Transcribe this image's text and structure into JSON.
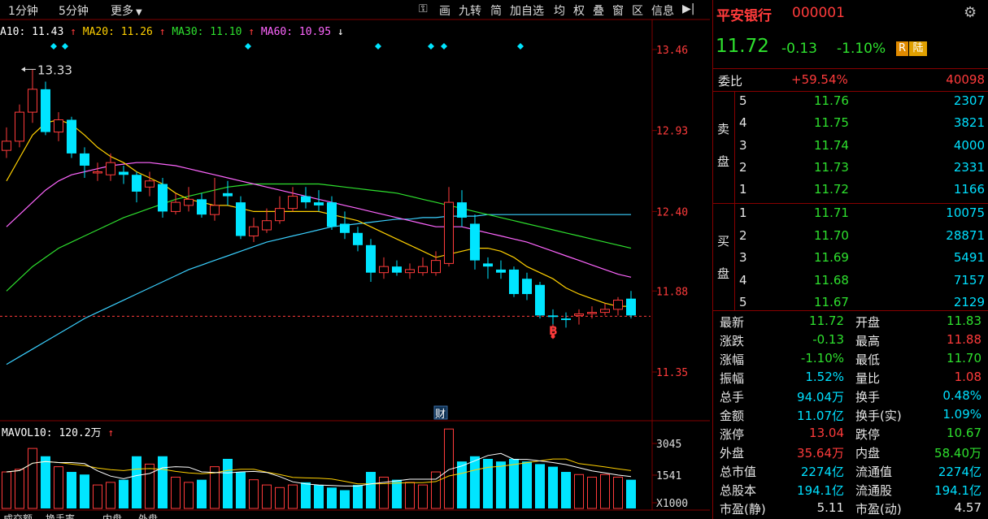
{
  "toolbar": {
    "period_1min": "1分钟",
    "period_5min": "5分钟",
    "more": "更多",
    "tools": [
      "画",
      "九转",
      "简",
      "加自选",
      "均",
      "权",
      "叠",
      "窗",
      "区",
      "信息"
    ]
  },
  "indicators": {
    "ma10": "A10: 11.43",
    "ma20": "MA20: 11.26",
    "ma30": "MA30: 11.10",
    "ma60": "MA60: 10.95",
    "ma10_arrow": "↑",
    "ma20_arrow": "↑",
    "ma30_arrow": "↑",
    "ma60_arrow": "↓"
  },
  "vol_indicator": {
    "label": "MAVOL10: 120.2万",
    "arrow": "↑"
  },
  "chart_data": {
    "type": "candlestick",
    "y_ticks": [
      "13.46",
      "12.93",
      "12.40",
      "11.88",
      "11.35"
    ],
    "vol_ticks": [
      "3045",
      "1541",
      "X1000"
    ],
    "high_label": "13.33",
    "low_marker": "B",
    "finance_marker": "财",
    "candles": [
      {
        "o": 12.8,
        "c": 12.86,
        "h": 12.95,
        "l": 12.75,
        "v": 1400,
        "up": true
      },
      {
        "o": 12.86,
        "c": 13.05,
        "h": 13.1,
        "l": 12.82,
        "v": 1500,
        "up": true
      },
      {
        "o": 13.05,
        "c": 13.2,
        "h": 13.33,
        "l": 12.98,
        "v": 2300,
        "up": true
      },
      {
        "o": 13.2,
        "c": 12.92,
        "h": 13.25,
        "l": 12.9,
        "v": 2000,
        "up": false
      },
      {
        "o": 12.92,
        "c": 13.0,
        "h": 13.05,
        "l": 12.86,
        "v": 1600,
        "up": true
      },
      {
        "o": 13.0,
        "c": 12.78,
        "h": 13.02,
        "l": 12.75,
        "v": 1400,
        "up": false
      },
      {
        "o": 12.78,
        "c": 12.7,
        "h": 12.82,
        "l": 12.62,
        "v": 1300,
        "up": false
      },
      {
        "o": 12.66,
        "c": 12.66,
        "h": 12.72,
        "l": 12.6,
        "v": 900,
        "up": true
      },
      {
        "o": 12.64,
        "c": 12.72,
        "h": 12.78,
        "l": 12.6,
        "v": 1000,
        "up": true
      },
      {
        "o": 12.66,
        "c": 12.64,
        "h": 12.7,
        "l": 12.58,
        "v": 1100,
        "up": false
      },
      {
        "o": 12.64,
        "c": 12.53,
        "h": 12.66,
        "l": 12.46,
        "v": 2000,
        "up": false
      },
      {
        "o": 12.56,
        "c": 12.6,
        "h": 12.66,
        "l": 12.5,
        "v": 1700,
        "up": true
      },
      {
        "o": 12.58,
        "c": 12.4,
        "h": 12.62,
        "l": 12.36,
        "v": 2000,
        "up": false
      },
      {
        "o": 12.4,
        "c": 12.46,
        "h": 12.52,
        "l": 12.38,
        "v": 1200,
        "up": true
      },
      {
        "o": 12.44,
        "c": 12.48,
        "h": 12.56,
        "l": 12.4,
        "v": 1000,
        "up": true
      },
      {
        "o": 12.48,
        "c": 12.38,
        "h": 12.52,
        "l": 12.36,
        "v": 1100,
        "up": false
      },
      {
        "o": 12.38,
        "c": 12.44,
        "h": 12.62,
        "l": 12.34,
        "v": 1600,
        "up": true
      },
      {
        "o": 12.52,
        "c": 12.5,
        "h": 12.6,
        "l": 12.44,
        "v": 1900,
        "up": false
      },
      {
        "o": 12.46,
        "c": 12.24,
        "h": 12.5,
        "l": 12.22,
        "v": 1400,
        "up": false
      },
      {
        "o": 12.24,
        "c": 12.3,
        "h": 12.36,
        "l": 12.2,
        "v": 1100,
        "up": true
      },
      {
        "o": 12.28,
        "c": 12.34,
        "h": 12.42,
        "l": 12.26,
        "v": 900,
        "up": true
      },
      {
        "o": 12.34,
        "c": 12.42,
        "h": 12.5,
        "l": 12.32,
        "v": 800,
        "up": true
      },
      {
        "o": 12.42,
        "c": 12.5,
        "h": 12.56,
        "l": 12.4,
        "v": 900,
        "up": true
      },
      {
        "o": 12.5,
        "c": 12.46,
        "h": 12.56,
        "l": 12.42,
        "v": 1000,
        "up": false
      },
      {
        "o": 12.46,
        "c": 12.44,
        "h": 12.54,
        "l": 12.4,
        "v": 900,
        "up": false
      },
      {
        "o": 12.46,
        "c": 12.3,
        "h": 12.5,
        "l": 12.28,
        "v": 800,
        "up": false
      },
      {
        "o": 12.32,
        "c": 12.26,
        "h": 12.4,
        "l": 12.22,
        "v": 700,
        "up": false
      },
      {
        "o": 12.26,
        "c": 12.18,
        "h": 12.3,
        "l": 12.14,
        "v": 900,
        "up": false
      },
      {
        "o": 12.18,
        "c": 12.0,
        "h": 12.22,
        "l": 11.94,
        "v": 1400,
        "up": false
      },
      {
        "o": 12.0,
        "c": 12.04,
        "h": 12.1,
        "l": 11.96,
        "v": 1200,
        "up": true
      },
      {
        "o": 12.04,
        "c": 12.0,
        "h": 12.08,
        "l": 11.98,
        "v": 1100,
        "up": false
      },
      {
        "o": 12.0,
        "c": 12.02,
        "h": 12.06,
        "l": 11.96,
        "v": 1000,
        "up": true
      },
      {
        "o": 12.0,
        "c": 12.04,
        "h": 12.1,
        "l": 11.98,
        "v": 900,
        "up": true
      },
      {
        "o": 12.0,
        "c": 12.08,
        "h": 12.14,
        "l": 11.98,
        "v": 1400,
        "up": true
      },
      {
        "o": 12.06,
        "c": 12.46,
        "h": 12.56,
        "l": 12.04,
        "v": 3045,
        "up": true
      },
      {
        "o": 12.46,
        "c": 12.36,
        "h": 12.54,
        "l": 12.3,
        "v": 1800,
        "up": false
      },
      {
        "o": 12.32,
        "c": 12.08,
        "h": 12.38,
        "l": 12.02,
        "v": 2000,
        "up": false
      },
      {
        "o": 12.06,
        "c": 12.04,
        "h": 12.1,
        "l": 11.96,
        "v": 1900,
        "up": false
      },
      {
        "o": 12.02,
        "c": 12.0,
        "h": 12.08,
        "l": 11.96,
        "v": 1800,
        "up": false
      },
      {
        "o": 12.02,
        "c": 11.86,
        "h": 12.04,
        "l": 11.84,
        "v": 1900,
        "up": false
      },
      {
        "o": 11.96,
        "c": 11.86,
        "h": 12.0,
        "l": 11.82,
        "v": 1800,
        "up": false
      },
      {
        "o": 11.92,
        "c": 11.72,
        "h": 11.94,
        "l": 11.7,
        "v": 1700,
        "up": false
      },
      {
        "o": 11.72,
        "c": 11.71,
        "h": 11.76,
        "l": 11.62,
        "v": 1600,
        "up": false
      },
      {
        "o": 11.7,
        "c": 11.69,
        "h": 11.74,
        "l": 11.64,
        "v": 1400,
        "up": false
      },
      {
        "o": 11.72,
        "c": 11.73,
        "h": 11.76,
        "l": 11.66,
        "v": 1300,
        "up": true
      },
      {
        "o": 11.74,
        "c": 11.74,
        "h": 11.78,
        "l": 11.7,
        "v": 1200,
        "up": true
      },
      {
        "o": 11.74,
        "c": 11.76,
        "h": 11.8,
        "l": 11.72,
        "v": 1300,
        "up": true
      },
      {
        "o": 11.76,
        "c": 11.82,
        "h": 11.84,
        "l": 11.72,
        "v": 1200,
        "up": true
      },
      {
        "o": 11.83,
        "c": 11.72,
        "h": 11.88,
        "l": 11.7,
        "v": 1100,
        "up": false
      }
    ],
    "ma10": [
      12.6,
      12.75,
      12.9,
      12.98,
      13.0,
      12.97,
      12.9,
      12.82,
      12.76,
      12.72,
      12.66,
      12.62,
      12.58,
      12.52,
      12.48,
      12.46,
      12.44,
      12.44,
      12.42,
      12.4,
      12.4,
      12.4,
      12.4,
      12.4,
      12.4,
      12.38,
      12.36,
      12.34,
      12.3,
      12.26,
      12.22,
      12.18,
      12.14,
      12.1,
      12.12,
      12.14,
      12.16,
      12.16,
      12.14,
      12.1,
      12.04,
      12.0,
      11.96,
      11.9,
      11.86,
      11.83,
      11.8,
      11.78,
      11.78
    ],
    "ma20": [
      12.3,
      12.38,
      12.46,
      12.54,
      12.6,
      12.64,
      12.66,
      12.68,
      12.7,
      12.71,
      12.72,
      12.72,
      12.71,
      12.7,
      12.68,
      12.66,
      12.64,
      12.62,
      12.6,
      12.58,
      12.56,
      12.54,
      12.52,
      12.5,
      12.48,
      12.46,
      12.44,
      12.42,
      12.4,
      12.38,
      12.36,
      12.34,
      12.32,
      12.3,
      12.3,
      12.3,
      12.28,
      12.26,
      12.24,
      12.22,
      12.2,
      12.17,
      12.14,
      12.11,
      12.08,
      12.05,
      12.02,
      11.99,
      11.97
    ],
    "ma30": [
      11.88,
      11.96,
      12.04,
      12.1,
      12.16,
      12.2,
      12.24,
      12.28,
      12.32,
      12.36,
      12.39,
      12.42,
      12.45,
      12.48,
      12.5,
      12.52,
      12.54,
      12.56,
      12.57,
      12.58,
      12.58,
      12.58,
      12.58,
      12.58,
      12.58,
      12.57,
      12.56,
      12.55,
      12.54,
      12.53,
      12.52,
      12.5,
      12.48,
      12.46,
      12.44,
      12.42,
      12.4,
      12.38,
      12.36,
      12.34,
      12.32,
      12.3,
      12.28,
      12.26,
      12.24,
      12.22,
      12.2,
      12.18,
      12.16
    ],
    "ma60": [
      11.4,
      11.45,
      11.5,
      11.55,
      11.6,
      11.65,
      11.7,
      11.74,
      11.78,
      11.82,
      11.86,
      11.9,
      11.94,
      11.98,
      12.02,
      12.05,
      12.08,
      12.11,
      12.14,
      12.17,
      12.2,
      12.22,
      12.24,
      12.26,
      12.28,
      12.3,
      12.31,
      12.32,
      12.33,
      12.34,
      12.35,
      12.35,
      12.36,
      12.36,
      12.37,
      12.37,
      12.37,
      12.38,
      12.38,
      12.38,
      12.38,
      12.38,
      12.38,
      12.38,
      12.38,
      12.38,
      12.38,
      12.38,
      12.38
    ],
    "ylim": [
      11.18,
      13.55
    ],
    "vol_max": 3300
  },
  "stock": {
    "name": "平安银行",
    "code": "000001",
    "price": "11.72",
    "change": "-0.13",
    "pct": "-1.10%",
    "badge_r": "R",
    "badge_lu": "陆"
  },
  "weibi": {
    "label": "委比",
    "pct": "+59.54%",
    "diff": "40098"
  },
  "sell_label": [
    "卖",
    "盘"
  ],
  "buy_label": [
    "买",
    "盘"
  ],
  "sell": [
    {
      "n": "5",
      "p": "11.76",
      "v": "2307"
    },
    {
      "n": "4",
      "p": "11.75",
      "v": "3821"
    },
    {
      "n": "3",
      "p": "11.74",
      "v": "4000"
    },
    {
      "n": "2",
      "p": "11.73",
      "v": "2331"
    },
    {
      "n": "1",
      "p": "11.72",
      "v": "1166"
    }
  ],
  "buy": [
    {
      "n": "1",
      "p": "11.71",
      "v": "10075"
    },
    {
      "n": "2",
      "p": "11.70",
      "v": "28871"
    },
    {
      "n": "3",
      "p": "11.69",
      "v": "5491"
    },
    {
      "n": "4",
      "p": "11.68",
      "v": "7157"
    },
    {
      "n": "5",
      "p": "11.67",
      "v": "2129"
    }
  ],
  "stats": [
    {
      "l1": "最新",
      "v1": "11.72",
      "c1": "green",
      "l2": "开盘",
      "v2": "11.83",
      "c2": "green"
    },
    {
      "l1": "涨跌",
      "v1": "-0.13",
      "c1": "green",
      "l2": "最高",
      "v2": "11.88",
      "c2": "red"
    },
    {
      "l1": "涨幅",
      "v1": "-1.10%",
      "c1": "green",
      "l2": "最低",
      "v2": "11.70",
      "c2": "green"
    },
    {
      "l1": "振幅",
      "v1": "1.52%",
      "c1": "cyan",
      "l2": "量比",
      "v2": "1.08",
      "c2": "red"
    },
    {
      "l1": "总手",
      "v1": "94.04万",
      "c1": "cyan",
      "l2": "换手",
      "v2": "0.48%",
      "c2": "cyan"
    },
    {
      "l1": "金额",
      "v1": "11.07亿",
      "c1": "cyan",
      "l2": "换手(实)",
      "v2": "1.09%",
      "c2": "cyan"
    },
    {
      "l1": "涨停",
      "v1": "13.04",
      "c1": "red",
      "l2": "跌停",
      "v2": "10.67",
      "c2": "green"
    },
    {
      "l1": "外盘",
      "v1": "35.64万",
      "c1": "red",
      "l2": "内盘",
      "v2": "58.40万",
      "c2": "green"
    },
    {
      "l1": "总市值",
      "v1": "2274亿",
      "c1": "cyan",
      "l2": "流通值",
      "v2": "2274亿",
      "c2": "cyan"
    },
    {
      "l1": "总股本",
      "v1": "194.1亿",
      "c1": "cyan",
      "l2": "流通股",
      "v2": "194.1亿",
      "c2": "cyan"
    },
    {
      "l1": "市盈(静)",
      "v1": "5.11",
      "c1": "white",
      "l2": "市盈(动)",
      "v2": "4.57",
      "c2": "white"
    }
  ],
  "bottom_tabs": [
    "成交额",
    "换手率",
    "内盘",
    "外盘"
  ],
  "colors": {
    "up": "#ff3b3b",
    "down": "#00e5ff",
    "ma10": "#ffffff",
    "ma20": "#ffd000",
    "ma30": "#ff66ff",
    "ma60": "#2ee02e",
    "ma_extra": "#3ad0ff",
    "grid": "#800000"
  }
}
